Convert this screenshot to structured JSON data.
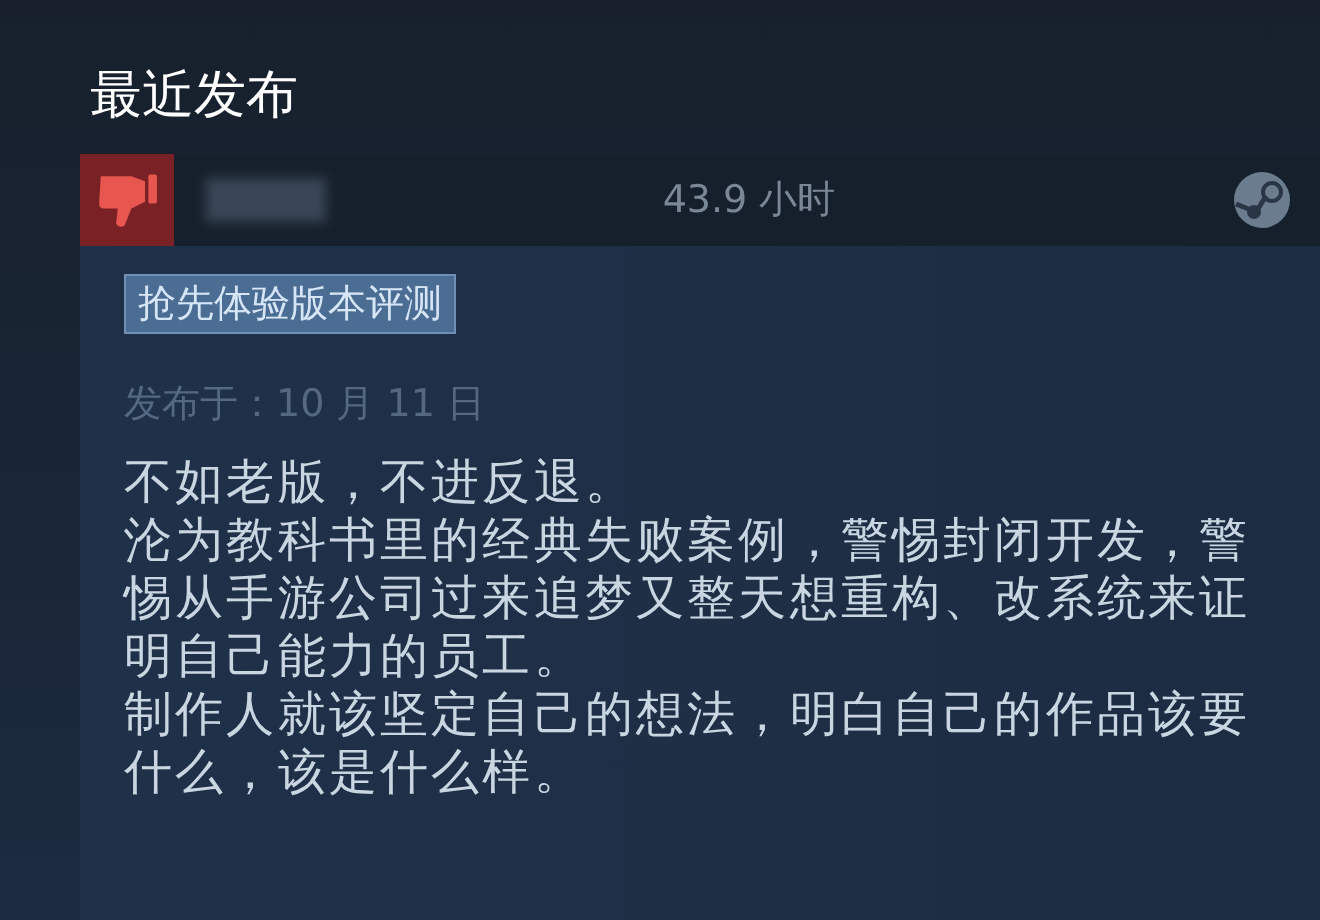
{
  "section_title": "最近发布",
  "review": {
    "recommended": false,
    "hours": "43.9 小时",
    "tag": "抢先体验版本评测",
    "posted": "发布于：10 月 11 日",
    "paragraphs": [
      "不如老版，不进反退。",
      "沦为教科书里的经典失败案例，警惕封闭开发，警惕从手游公司过来追梦又整天想重构、改系统来证明自己能力的员工。",
      "制作人就该坚定自己的想法，明白自己的作品该要什么，该是什么样。"
    ]
  }
}
